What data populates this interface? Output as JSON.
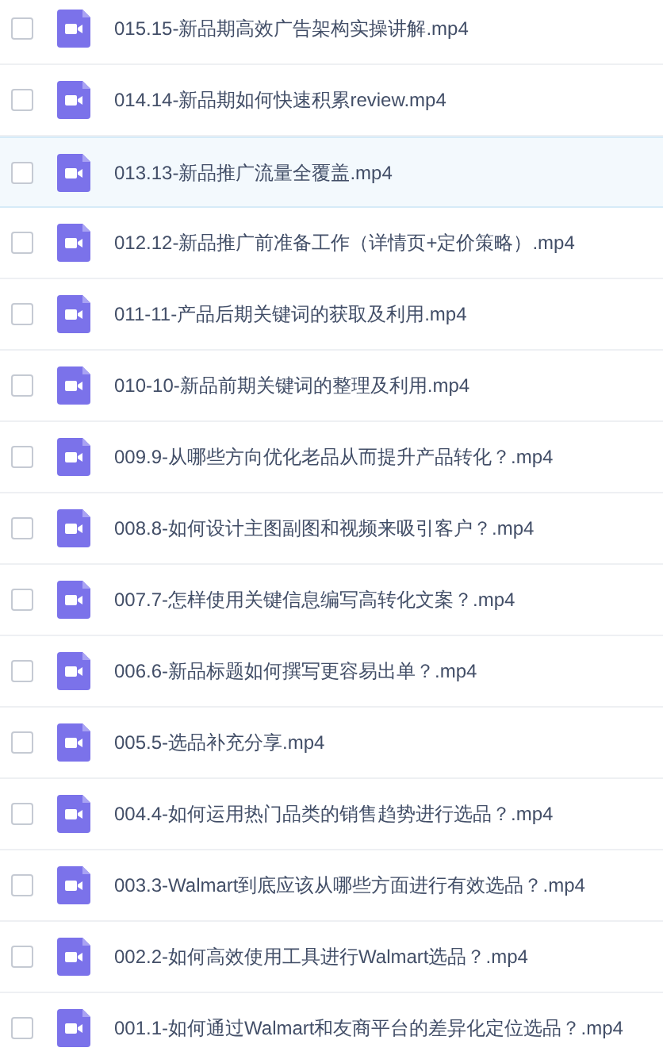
{
  "files": [
    {
      "name": "015.15-新品期高效广告架构实操讲解.mp4",
      "selected": false,
      "checked": false
    },
    {
      "name": "014.14-新品期如何快速积累review.mp4",
      "selected": false,
      "checked": false
    },
    {
      "name": "013.13-新品推广流量全覆盖.mp4",
      "selected": true,
      "checked": false
    },
    {
      "name": "012.12-新品推广前准备工作（详情页+定价策略）.mp4",
      "selected": false,
      "checked": false
    },
    {
      "name": "011-11-产品后期关键词的获取及利用.mp4",
      "selected": false,
      "checked": false
    },
    {
      "name": "010-10-新品前期关键词的整理及利用.mp4",
      "selected": false,
      "checked": false
    },
    {
      "name": "009.9-从哪些方向优化老品从而提升产品转化？.mp4",
      "selected": false,
      "checked": false
    },
    {
      "name": "008.8-如何设计主图副图和视频来吸引客户？.mp4",
      "selected": false,
      "checked": false
    },
    {
      "name": "007.7-怎样使用关键信息编写高转化文案？.mp4",
      "selected": false,
      "checked": false
    },
    {
      "name": "006.6-新品标题如何撰写更容易出单？.mp4",
      "selected": false,
      "checked": false
    },
    {
      "name": "005.5-选品补充分享.mp4",
      "selected": false,
      "checked": false
    },
    {
      "name": "004.4-如何运用热门品类的销售趋势进行选品？.mp4",
      "selected": false,
      "checked": false
    },
    {
      "name": "003.3-Walmart到底应该从哪些方面进行有效选品？.mp4",
      "selected": false,
      "checked": false
    },
    {
      "name": "002.2-如何高效使用工具进行Walmart选品？.mp4",
      "selected": false,
      "checked": false
    },
    {
      "name": "001.1-如何通过Walmart和友商平台的差异化定位选品？.mp4",
      "selected": false,
      "checked": false
    }
  ]
}
